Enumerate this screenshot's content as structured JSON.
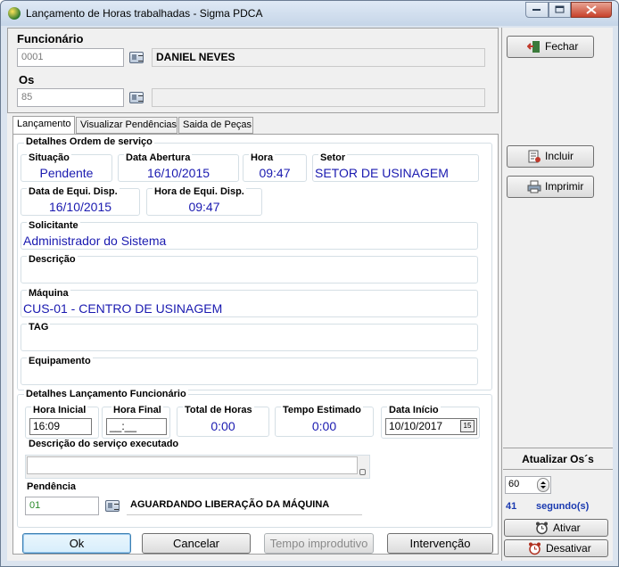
{
  "window": {
    "title": "Lançamento de Horas trabalhadas - Sigma PDCA"
  },
  "funcionario": {
    "label": "Funcionário",
    "code": "0001",
    "name": "DANIEL NEVES"
  },
  "os": {
    "label": "Os",
    "code": "85",
    "name": ""
  },
  "tabs": [
    {
      "label": "Lançamento"
    },
    {
      "label": "Visualizar Pendências"
    },
    {
      "label": "Saida de Peças"
    }
  ],
  "ordem": {
    "group_title": "Detalhes Ordem de serviço",
    "situacao": {
      "label": "Situação",
      "value": "Pendente"
    },
    "data_abertura": {
      "label": "Data Abertura",
      "value": "16/10/2015"
    },
    "hora": {
      "label": "Hora",
      "value": "09:47"
    },
    "setor": {
      "label": "Setor",
      "value": "SETOR DE USINAGEM"
    },
    "data_equi": {
      "label": "Data de Equi. Disp.",
      "value": "16/10/2015"
    },
    "hora_equi": {
      "label": "Hora de Equi. Disp.",
      "value": "09:47"
    },
    "solicitante": {
      "label": "Solicitante",
      "value": "Administrador do Sistema"
    },
    "descricao": {
      "label": "Descrição",
      "value": ""
    },
    "maquina": {
      "label": "Máquina",
      "value": "CUS-01 - CENTRO DE USINAGEM"
    },
    "tag": {
      "label": "TAG",
      "value": ""
    },
    "equipamento": {
      "label": "Equipamento",
      "value": ""
    }
  },
  "lancamento": {
    "group_title": "Detalhes Lançamento Funcionário",
    "hora_inicial": {
      "label": "Hora Inicial",
      "value": "16:09"
    },
    "hora_final": {
      "label": "Hora Final",
      "value": "__:__"
    },
    "total_horas": {
      "label": "Total de Horas",
      "value": "0:00"
    },
    "tempo_estimado": {
      "label": "Tempo Estimado",
      "value": "0:00"
    },
    "data_inicio": {
      "label": "Data Início",
      "value": "10/10/2017",
      "calendar_glyph": "15"
    },
    "descricao_servico": {
      "label": "Descrição do serviço executado",
      "value": ""
    },
    "pendencia": {
      "label": "Pendência",
      "code": "01",
      "name": "AGUARDANDO LIBERAÇÃO DA MÁQUINA"
    }
  },
  "bottom_buttons": {
    "ok": "Ok",
    "cancelar": "Cancelar",
    "tempo_improdutivo": "Tempo improdutivo",
    "intervencao": "Intervenção"
  },
  "right_panel": {
    "fechar": "Fechar",
    "incluir": "Incluir",
    "imprimir": "Imprimir",
    "atualizar_title": "Atualizar Os´s",
    "interval_value": "60",
    "countdown_value": "41",
    "countdown_unit": "segundo(s)",
    "ativar": "Ativar",
    "desativar": "Desativar"
  }
}
